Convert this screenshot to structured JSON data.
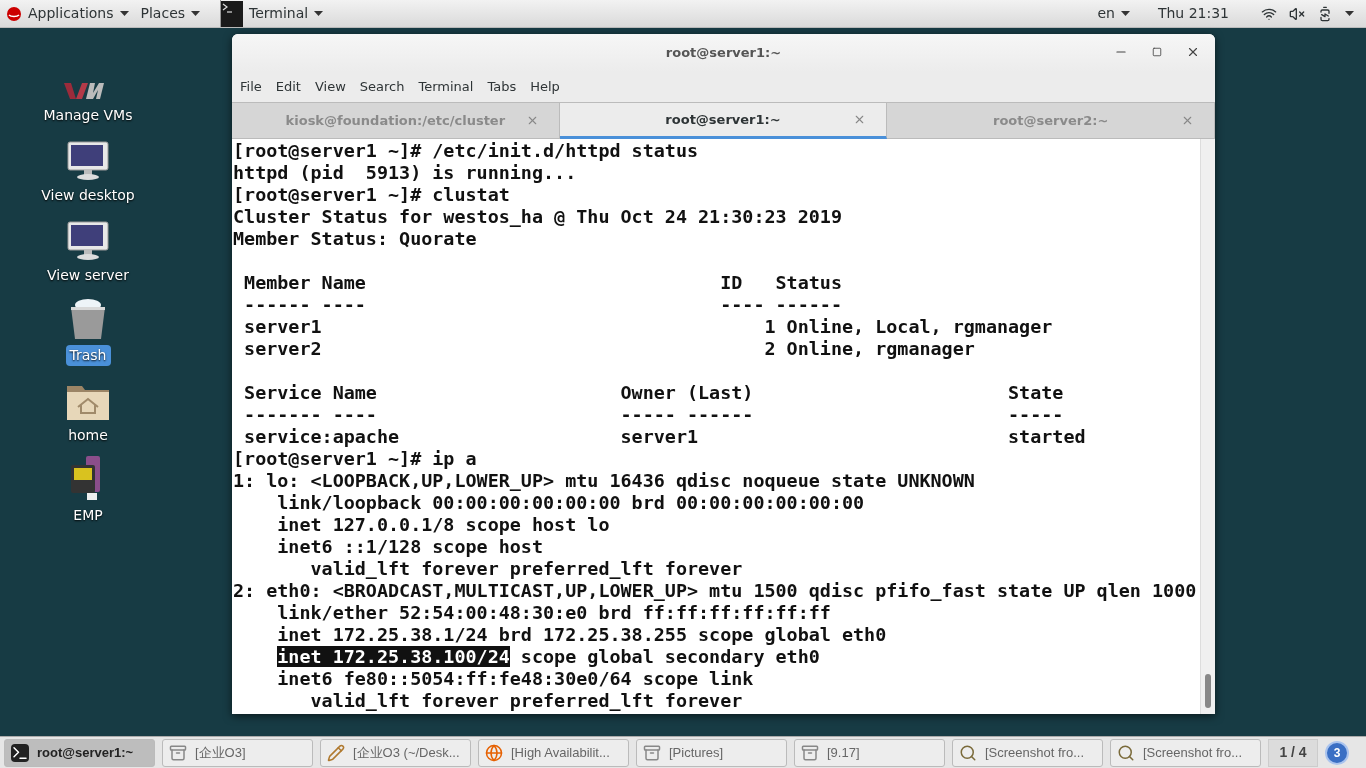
{
  "top_bar": {
    "menus": [
      {
        "label": "Applications",
        "kind": "logo"
      },
      {
        "label": "Places",
        "kind": "plain"
      },
      {
        "label": "Terminal",
        "kind": "terminal"
      }
    ],
    "language": "en",
    "clock": "Thu 21:31"
  },
  "desktop_icons": [
    {
      "label": "Manage VMs",
      "kind": "vm",
      "selected": false
    },
    {
      "label": "View desktop",
      "kind": "monitor",
      "selected": false
    },
    {
      "label": "View server",
      "kind": "monitor",
      "selected": false
    },
    {
      "label": "Trash",
      "kind": "trash",
      "selected": true
    },
    {
      "label": "home",
      "kind": "folder",
      "selected": false
    },
    {
      "label": "EMP",
      "kind": "device",
      "selected": false
    }
  ],
  "window": {
    "title": "root@server1:~",
    "menu": [
      "File",
      "Edit",
      "View",
      "Search",
      "Terminal",
      "Tabs",
      "Help"
    ],
    "tabs": [
      {
        "label": "kiosk@foundation:/etc/cluster",
        "selected": false
      },
      {
        "label": "root@server1:~",
        "selected": true
      },
      {
        "label": "root@server2:~",
        "selected": false
      }
    ],
    "lines": [
      {
        "kind": "text",
        "text": "[root@server1 ~]# /etc/init.d/httpd status"
      },
      {
        "kind": "text",
        "text": "httpd (pid  5913) is running..."
      },
      {
        "kind": "text",
        "text": "[root@server1 ~]# clustat"
      },
      {
        "kind": "text",
        "text": "Cluster Status for westos_ha @ Thu Oct 24 21:30:23 2019"
      },
      {
        "kind": "text",
        "text": "Member Status: Quorate"
      },
      {
        "kind": "blank"
      },
      {
        "kind": "text",
        "text": " Member Name                                ID   Status"
      },
      {
        "kind": "text",
        "text": " ------ ----                                ---- ------"
      },
      {
        "kind": "text",
        "text": " server1                                        1 Online, Local, rgmanager"
      },
      {
        "kind": "text",
        "text": " server2                                        2 Online, rgmanager"
      },
      {
        "kind": "blank"
      },
      {
        "kind": "text",
        "text": " Service Name                      Owner (Last)                       State"
      },
      {
        "kind": "text",
        "text": " ------- ----                      ----- ------                       -----"
      },
      {
        "kind": "text",
        "text": " service:apache                    server1                            started"
      },
      {
        "kind": "text",
        "text": "[root@server1 ~]# ip a"
      },
      {
        "kind": "text",
        "text": "1: lo: <LOOPBACK,UP,LOWER_UP> mtu 16436 qdisc noqueue state UNKNOWN"
      },
      {
        "kind": "text",
        "text": "    link/loopback 00:00:00:00:00:00 brd 00:00:00:00:00:00"
      },
      {
        "kind": "text",
        "text": "    inet 127.0.0.1/8 scope host lo"
      },
      {
        "kind": "text",
        "text": "    inet6 ::1/128 scope host"
      },
      {
        "kind": "text",
        "text": "       valid_lft forever preferred_lft forever"
      },
      {
        "kind": "text",
        "text": "2: eth0: <BROADCAST,MULTICAST,UP,LOWER_UP> mtu 1500 qdisc pfifo_fast state UP qlen 1000"
      },
      {
        "kind": "text",
        "text": "    link/ether 52:54:00:48:30:e0 brd ff:ff:ff:ff:ff:ff"
      },
      {
        "kind": "text",
        "text": "    inet 172.25.38.1/24 brd 172.25.38.255 scope global eth0"
      },
      {
        "kind": "marked",
        "segments": [
          {
            "text": "inet 172.25.38.100/24",
            "selected": true
          },
          {
            "text": " scope global secondary eth0",
            "selected": false
          }
        ]
      },
      {
        "kind": "text",
        "text": "    inet6 fe80::5054:ff:fe48:30e0/64 scope link"
      },
      {
        "kind": "text",
        "text": "       valid_lft forever preferred_lft forever"
      }
    ]
  },
  "taskbar": {
    "items": [
      {
        "label": "root@server1:~",
        "kind": "terminal",
        "selected": true
      },
      {
        "label": "[企业O3]",
        "kind": "files",
        "selected": false
      },
      {
        "label": "[企业O3 (~/Desk...",
        "kind": "editor",
        "selected": false
      },
      {
        "label": "[High Availabilit...",
        "kind": "browser",
        "selected": false
      },
      {
        "label": "[Pictures]",
        "kind": "files",
        "selected": false
      },
      {
        "label": "[9.17]",
        "kind": "files",
        "selected": false
      },
      {
        "label": "[Screenshot fro...",
        "kind": "viewer",
        "selected": false
      },
      {
        "label": "[Screenshot fro...",
        "kind": "viewer",
        "selected": false
      }
    ],
    "workspace": "1 / 4",
    "badge": "3"
  }
}
